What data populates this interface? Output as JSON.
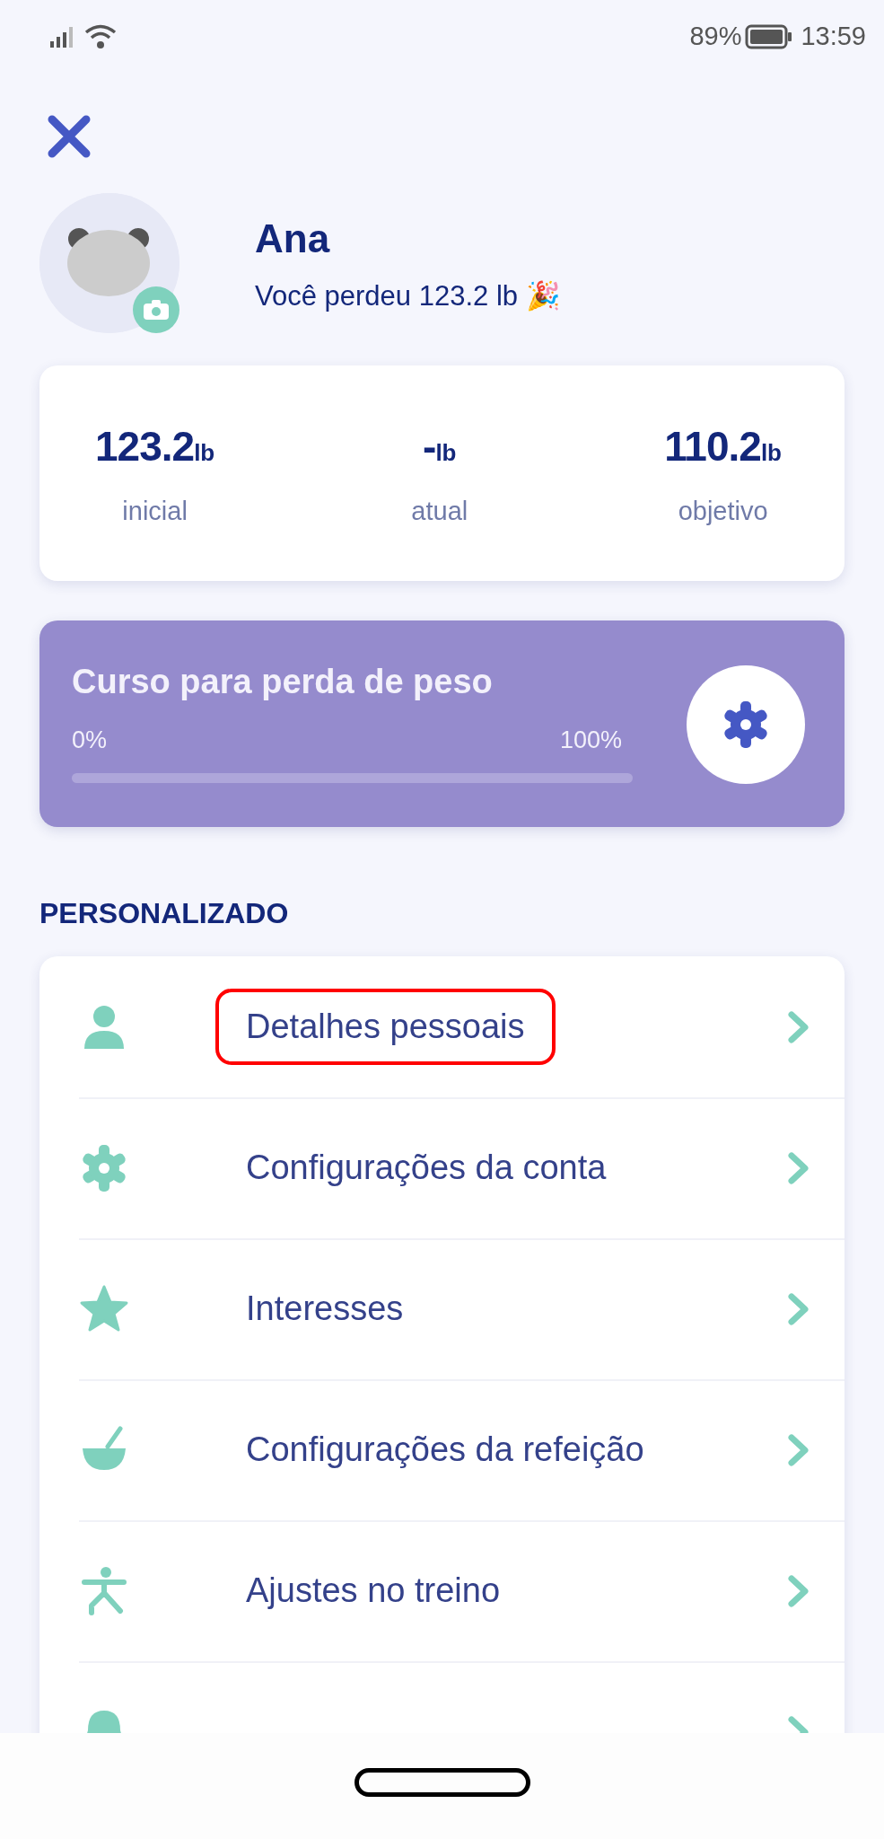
{
  "status_bar": {
    "battery": "89%",
    "time": "13:59"
  },
  "profile": {
    "name": "Ana",
    "message": "Você perdeu 123.2 lb 🎉"
  },
  "stats": [
    {
      "value": "123.2",
      "unit": "lb",
      "label": "inicial"
    },
    {
      "value": "-",
      "unit": "lb",
      "label": "atual"
    },
    {
      "value": "110.2",
      "unit": "lb",
      "label": "objetivo"
    }
  ],
  "course": {
    "title": "Curso para perda de peso",
    "start": "0%",
    "end": "100%",
    "level": 0
  },
  "section_title": "PERSONALIZADO",
  "menu": [
    {
      "kind": "person",
      "label": "Detalhes pessoais",
      "highlighted": true
    },
    {
      "kind": "gear",
      "label": "Configurações da conta",
      "highlighted": false
    },
    {
      "kind": "star",
      "label": "Interesses",
      "highlighted": false
    },
    {
      "kind": "bowl",
      "label": "Configurações da refeição",
      "highlighted": false
    },
    {
      "kind": "exercise",
      "label": "Ajustes no treino",
      "highlighted": false
    },
    {
      "kind": "bell"
    }
  ]
}
